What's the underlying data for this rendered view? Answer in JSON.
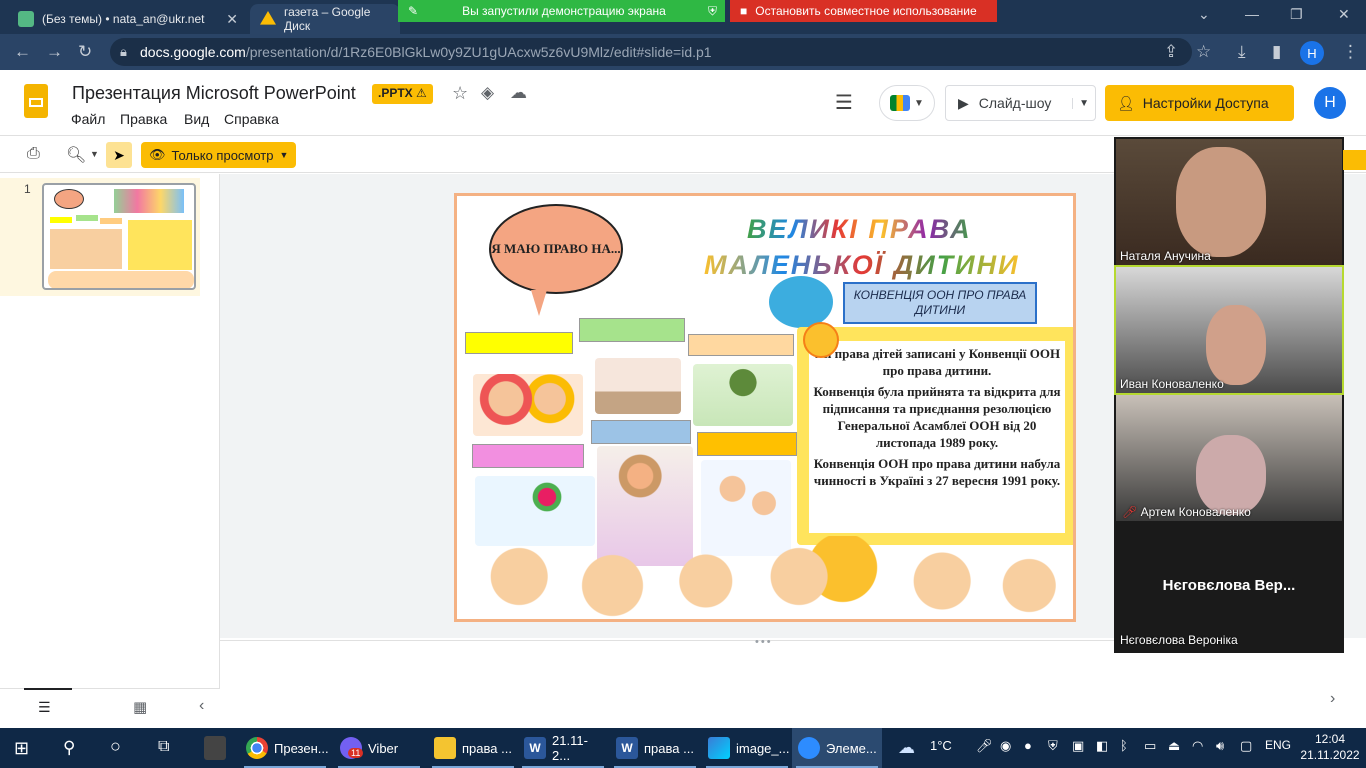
{
  "browser": {
    "tabs": [
      {
        "title": "(Без темы) • nata_an@ukr.net",
        "fav": "#54b884"
      },
      {
        "title": "газета – Google Диск",
        "fav": "#fbbc04"
      }
    ],
    "share_banner": "Вы запустили демонстрацию экрана",
    "stop_share": "Остановить совместное использование",
    "url_host": "docs.google.com",
    "url_path": "/presentation/d/1Rz6E0BlGkLw0y9ZU1gUAcxw5z6vU9Mlz/edit#slide=id.p1",
    "profile_letter": "H"
  },
  "app": {
    "title": "Презентация Microsoft PowerPoint",
    "badge": ".PPTX",
    "menu": [
      "Файл",
      "Правка",
      "Вид",
      "Справка"
    ],
    "slideshow": "Слайд-шоу",
    "access": "Настройки Доступа",
    "avatar": "H",
    "view_mode": "Только просмотр",
    "slide_number": "1"
  },
  "slide": {
    "cloud_text": "Я МАЮ ПРАВО НА...",
    "title_line1": "ВЕЛИКІ ПРАВА",
    "title_line2": "МАЛЕНЬКОЇ ДИТИНИ",
    "convention": "КОНВЕНЦІЯ ООН ПРО ПРАВА ДИТИНИ",
    "para1": "Усі права дітей записані у Конвенції ООН про права дитини.",
    "para2": "Конвенція була прийнята та відкрита для підписання та приєднання резолюцією Генеральної Асамблеї ООН від 20 листопада 1989 року.",
    "para3": "Конвенція ООН про права дитини набула чинності в Україні з 27 вересня 1991 року."
  },
  "participants": [
    {
      "name": "Наталя Анучина",
      "muted": false
    },
    {
      "name": "Иван Коноваленко",
      "muted": false
    },
    {
      "name": "Артем Коноваленко",
      "muted": true
    },
    {
      "name": "Нєговєлова Вероніка",
      "label": "Нєговєлова Вер...",
      "muted": false
    }
  ],
  "taskbar": {
    "apps": [
      {
        "label": "Презен...",
        "color": "#ea4335"
      },
      {
        "label": "Viber",
        "color": "#7360f2",
        "badge": "11"
      },
      {
        "label": "права ...",
        "color": "#f4c430"
      },
      {
        "label": "21.11-2...",
        "color": "#2b579a"
      },
      {
        "label": "права ...",
        "color": "#2b579a"
      },
      {
        "label": "image_...",
        "color": "#3a7bd5"
      },
      {
        "label": "Элеме...",
        "color": "#2d8cff"
      }
    ],
    "weather": "1°C",
    "lang": "ENG",
    "time": "12:04",
    "date": "21.11.2022"
  }
}
